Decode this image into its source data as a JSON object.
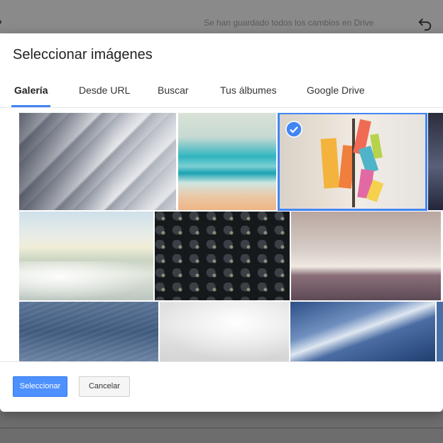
{
  "background": {
    "status_text": "Se han guardado todos los cambios en Drive"
  },
  "dialog": {
    "title": "Seleccionar imágenes",
    "tabs": [
      {
        "label": "Galería",
        "active": true
      },
      {
        "label": "Desde URL",
        "active": false
      },
      {
        "label": "Buscar",
        "active": false
      },
      {
        "label": "Tus álbumes",
        "active": false
      },
      {
        "label": "Google Drive",
        "active": false
      }
    ],
    "gallery": {
      "images": [
        {
          "name": "gallery-image-wood-diagonal",
          "selected": false
        },
        {
          "name": "gallery-image-ocean-waves",
          "selected": false
        },
        {
          "name": "gallery-image-sticky-notes",
          "selected": true
        },
        {
          "name": "gallery-image-dark-partial",
          "selected": false
        },
        {
          "name": "gallery-image-beach-shore",
          "selected": false
        },
        {
          "name": "gallery-image-typewriter",
          "selected": false
        },
        {
          "name": "gallery-image-sea-horizon",
          "selected": false
        },
        {
          "name": "gallery-image-blue-texture",
          "selected": false
        },
        {
          "name": "gallery-image-clouds",
          "selected": false
        },
        {
          "name": "gallery-image-sand-dune",
          "selected": false
        }
      ]
    },
    "buttons": {
      "select": "Seleccionar",
      "cancel": "Cancelar"
    },
    "colors": {
      "accent": "#4285f4",
      "primary_button": "#4d90fe"
    }
  }
}
